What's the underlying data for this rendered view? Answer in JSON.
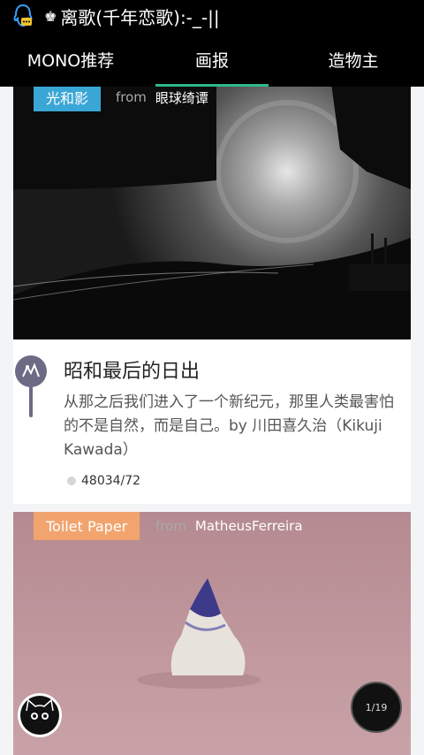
{
  "status_bar": {
    "notification_icon": "qq-penguin-icon",
    "music_icon": "crown-icon",
    "now_playing": "离歌(千年恋歌):-_-||"
  },
  "tabs": [
    {
      "label": "MONO推荐",
      "active": false
    },
    {
      "label": "画报",
      "active": true
    },
    {
      "label": "造物主",
      "active": false
    }
  ],
  "cards": [
    {
      "tag": "光和影",
      "tag_color": "#3aa6d6",
      "from_label": "from",
      "source": "眼球绮谭",
      "title": "昭和最后的日出",
      "description": "从那之后我们进入了一个新纪元，那里人类最害怕的不是自然，而是自己。by 川田喜久治（Kikuji Kawada）",
      "stats": "48034/72"
    },
    {
      "tag": "Toilet Paper",
      "tag_color": "#f2a46f",
      "from_label": "from",
      "source": "MatheusFerreira"
    }
  ],
  "pager": "1/19",
  "accent_color": "#2fb889"
}
